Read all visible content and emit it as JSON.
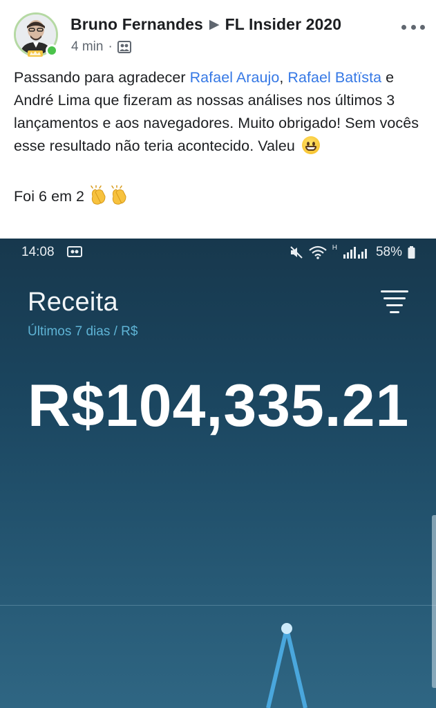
{
  "post": {
    "author": "Bruno Fernandes",
    "group": "FL Insider 2020",
    "time": "4 min",
    "separator": "·",
    "privacy_icon": "group-privacy-icon",
    "more_icon": "more-options-icon",
    "lines": {
      "l1_prefix": "Passando para agradecer ",
      "mention1": "Rafael Araujo",
      "comma": ",",
      "mention2": "Rafael Batïsta",
      "l2": "e André Lima que fizeram as nossas análises nos últimos 3 lançamentos e aos navegadores. Muito obrigado! Sem vocês esse resultado não teria acontecido. Valeu",
      "l3": "Foi 6 em 2"
    },
    "colors": {
      "link": "#3578e5",
      "online": "#4bc34b"
    }
  },
  "phone": {
    "status": {
      "time": "14:08",
      "signal_label": "H",
      "battery": "58%"
    },
    "dashboard": {
      "title": "Receita",
      "subtitle": "Últimos 7 dias / R$",
      "value": "R$104,335.21"
    },
    "colors": {
      "accent": "#5fb4d6",
      "chart_line": "#4aa7dd"
    }
  }
}
